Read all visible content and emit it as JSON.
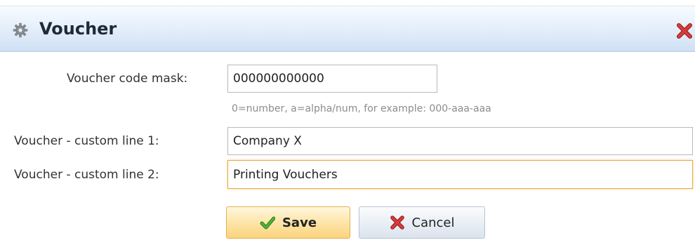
{
  "dialog": {
    "title": "Voucher",
    "title_icon": "gear-icon",
    "close_icon": "close-icon"
  },
  "form": {
    "code_mask": {
      "label": "Voucher code mask:",
      "value": "000000000000",
      "hint": "0=number, a=alpha/num, for example: 000-aaa-aaa"
    },
    "custom_line_1": {
      "label": "Voucher - custom line 1:",
      "value": "Company X"
    },
    "custom_line_2": {
      "label": "Voucher - custom line 2:",
      "value": "Printing Vouchers"
    }
  },
  "actions": {
    "save_label": "Save",
    "save_icon": "checkmark-icon",
    "cancel_label": "Cancel",
    "cancel_icon": "x-icon"
  },
  "colors": {
    "titlebar_gradient_bottom": "#cfe0f4",
    "close_red": "#c62828",
    "check_green": "#3c9a28",
    "focus_border": "#e9a93d",
    "save_button_bg": "#fde3a4",
    "cancel_button_bg": "#e8eef5"
  }
}
